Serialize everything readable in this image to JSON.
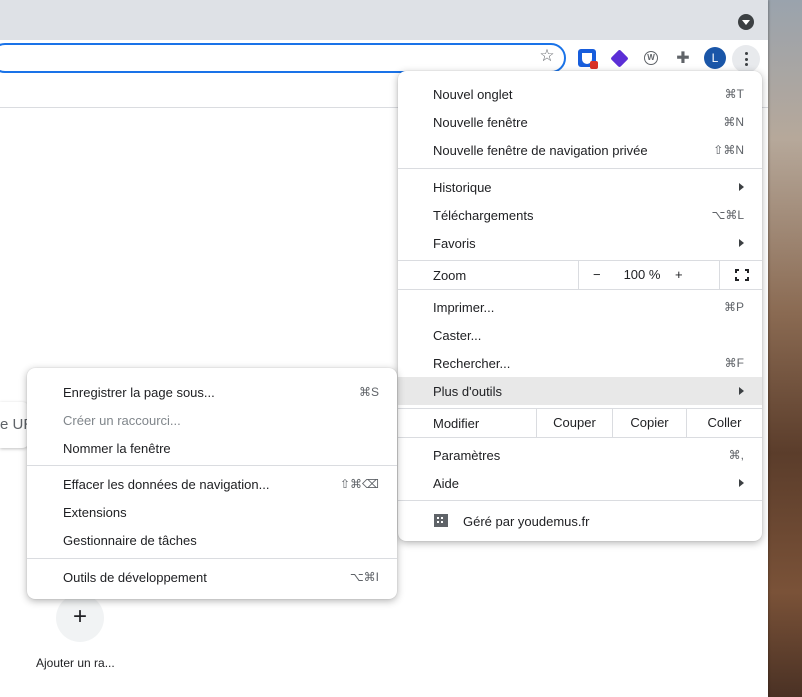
{
  "colors": {
    "accent": "#1a73e8",
    "avatar": "#1a56a8",
    "highlight": "#e8e8e8"
  },
  "toolbar": {
    "avatar_initial": "L",
    "icons": [
      "star-icon",
      "bitwarden-extension-icon",
      "layers-extension-icon",
      "wordpress-extension-icon",
      "puzzle-icon",
      "kebab-menu-icon"
    ]
  },
  "ntp": {
    "omnibox_peek": "e UR",
    "add_shortcut": "+",
    "add_shortcut_label": "Ajouter un ra..."
  },
  "main_menu": {
    "new_tab": {
      "label": "Nouvel onglet",
      "shortcut": "⌘T"
    },
    "new_window": {
      "label": "Nouvelle fenêtre",
      "shortcut": "⌘N"
    },
    "incognito": {
      "label": "Nouvelle fenêtre de navigation privée",
      "shortcut": "⇧⌘N"
    },
    "history": {
      "label": "Historique"
    },
    "downloads": {
      "label": "Téléchargements",
      "shortcut": "⌥⌘L"
    },
    "bookmarks": {
      "label": "Favoris"
    },
    "zoom": {
      "label": "Zoom",
      "minus": "−",
      "value": "100 %",
      "plus": "+"
    },
    "print": {
      "label": "Imprimer...",
      "shortcut": "⌘P"
    },
    "cast": {
      "label": "Caster..."
    },
    "find": {
      "label": "Rechercher...",
      "shortcut": "⌘F"
    },
    "more_tools": {
      "label": "Plus d'outils"
    },
    "edit": {
      "label": "Modifier",
      "cut": "Couper",
      "copy": "Copier",
      "paste": "Coller"
    },
    "settings": {
      "label": "Paramètres",
      "shortcut": "⌘,"
    },
    "help": {
      "label": "Aide"
    },
    "managed": {
      "label": "Géré par youdemus.fr"
    }
  },
  "sub_menu": {
    "save_page": {
      "label": "Enregistrer la page sous...",
      "shortcut": "⌘S"
    },
    "create_shortcut": {
      "label": "Créer un raccourci..."
    },
    "name_window": {
      "label": "Nommer la fenêtre"
    },
    "clear_data": {
      "label": "Effacer les données de navigation...",
      "shortcut": "⇧⌘⌫"
    },
    "extensions": {
      "label": "Extensions"
    },
    "task_manager": {
      "label": "Gestionnaire de tâches"
    },
    "dev_tools": {
      "label": "Outils de développement",
      "shortcut": "⌥⌘I"
    }
  }
}
